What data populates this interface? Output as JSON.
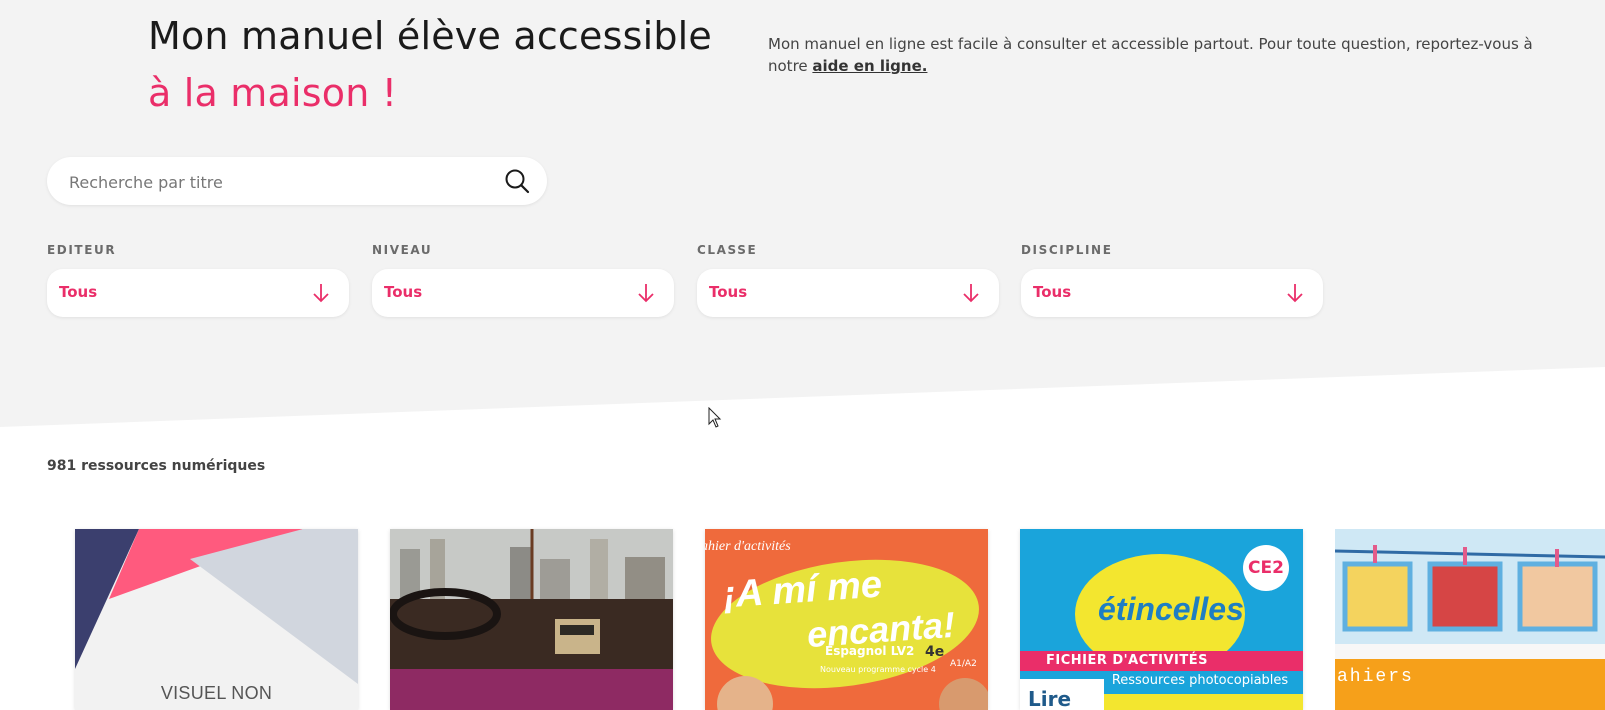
{
  "hero": {
    "title_line1": "Mon manuel élève accessible",
    "title_line2": "à la maison !",
    "description": "Mon manuel en ligne est facile à consulter et accessible partout. Pour toute question, reportez-vous à notre ",
    "help_link": "aide en ligne."
  },
  "search": {
    "placeholder": "Recherche par titre",
    "value": ""
  },
  "filters": [
    {
      "label": "EDITEUR",
      "value": "Tous"
    },
    {
      "label": "NIVEAU",
      "value": "Tous"
    },
    {
      "label": "CLASSE",
      "value": "Tous"
    },
    {
      "label": "DISCIPLINE",
      "value": "Tous"
    }
  ],
  "results": {
    "count_text": "981 ressources numériques"
  },
  "cards": [
    {
      "text": "VISUEL NON\nDISPONIBLE"
    },
    {
      "text": ""
    },
    {
      "top": "ahier d'activités",
      "title1": "¡A mí me",
      "title2": "encanta!",
      "sub": "Espagnol LV2",
      "sub2": "Nouveau programme cycle 4",
      "level": "4e",
      "level2": "A1/A2"
    },
    {
      "badge": "CE2",
      "brand": "étincelles",
      "band1": "FICHIER D'ACTIVITÉS",
      "band2": "Ressources photocopiables",
      "lire": "Lire"
    },
    {
      "word": "ahiers"
    }
  ],
  "colors": {
    "accent": "#ea2e69",
    "hero_bg": "#f3f3f3"
  }
}
